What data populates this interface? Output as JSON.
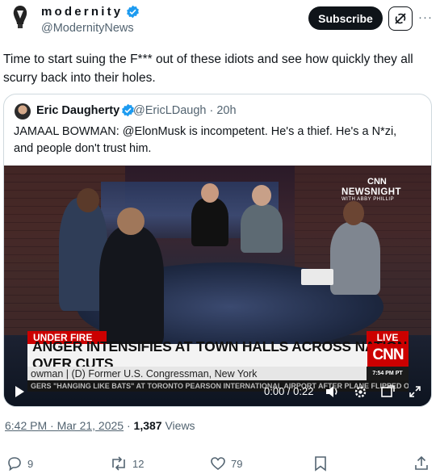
{
  "author": {
    "display_name": "modernity",
    "handle": "@ModernityNews"
  },
  "header": {
    "subscribe_label": "Subscribe",
    "more_label": "···"
  },
  "tweet": {
    "text": "Time to start suing the F*** out of these idiots and see how quickly they all scurry back into their holes."
  },
  "quote": {
    "display_name": "Eric Daugherty",
    "handle_time": "@EricLDaugh · 20h",
    "text": "JAMAAL BOWMAN: @ElonMusk is incompetent. He's a thief. He's a N*zi, and people don't trust him."
  },
  "video": {
    "network_small": "CNN",
    "show_name": "NEWSNIGHT",
    "show_sub": "WITH ABBY PHILLIP",
    "tag_left": "UNDER FIRE",
    "tag_right": "LIVE",
    "headline": "ANGER INTENSIFIES AT TOWN HALLS ACROSS NATION OVER CUTS",
    "network_big": "CNN",
    "subline": "owman  |  (D) Former U.S. Congressman, New York",
    "clock": "7:54 PM PT",
    "ticker": "GERS \"HANGING LIKE BATS\" AT TORONTO PEARSON INTERNATIONAL AIRPORT AFTER PLANE FLIPPED OVER · NEW RESTRICTIONS ON ROUGH",
    "time_display": "0:00 / 0:22"
  },
  "footer": {
    "time": "6:42 PM · Mar 21, 2025",
    "separator": " · ",
    "views_count": "1,387",
    "views_label": " Views",
    "replies": "9",
    "reposts": "12",
    "likes": "79"
  },
  "colors": {
    "verified_blue": "#1d9bf0",
    "text_primary": "#0f1419",
    "text_secondary": "#536471",
    "cnn_red": "#cc0000"
  },
  "icons": [
    "verified-badge-icon",
    "grok-icon",
    "more-icon",
    "play-icon",
    "volume-icon",
    "settings-icon",
    "pip-icon",
    "fullscreen-icon",
    "reply-icon",
    "repost-icon",
    "like-icon",
    "bookmark-icon",
    "share-icon"
  ]
}
